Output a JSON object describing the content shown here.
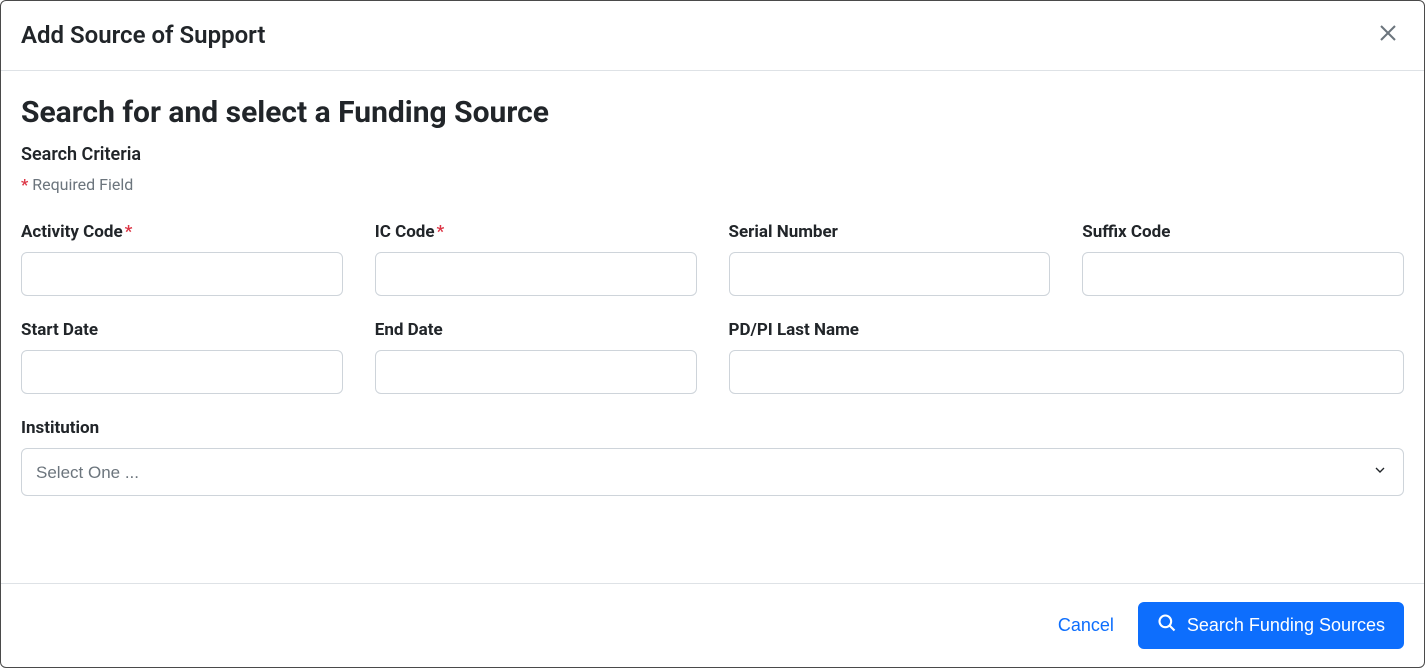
{
  "modal": {
    "title": "Add Source of Support"
  },
  "body": {
    "heading": "Search for and select a Funding Source",
    "subheading": "Search Criteria",
    "required_note": "Required Field"
  },
  "fields": {
    "activity_code": {
      "label": "Activity Code",
      "value": "",
      "required": true
    },
    "ic_code": {
      "label": "IC Code",
      "value": "",
      "required": true
    },
    "serial_number": {
      "label": "Serial Number",
      "value": ""
    },
    "suffix_code": {
      "label": "Suffix Code",
      "value": ""
    },
    "start_date": {
      "label": "Start Date",
      "value": ""
    },
    "end_date": {
      "label": "End Date",
      "value": ""
    },
    "pdpi_last_name": {
      "label": "PD/PI Last Name",
      "value": ""
    },
    "institution": {
      "label": "Institution",
      "placeholder": "Select One ..."
    }
  },
  "footer": {
    "cancel": "Cancel",
    "search": "Search Funding Sources"
  }
}
